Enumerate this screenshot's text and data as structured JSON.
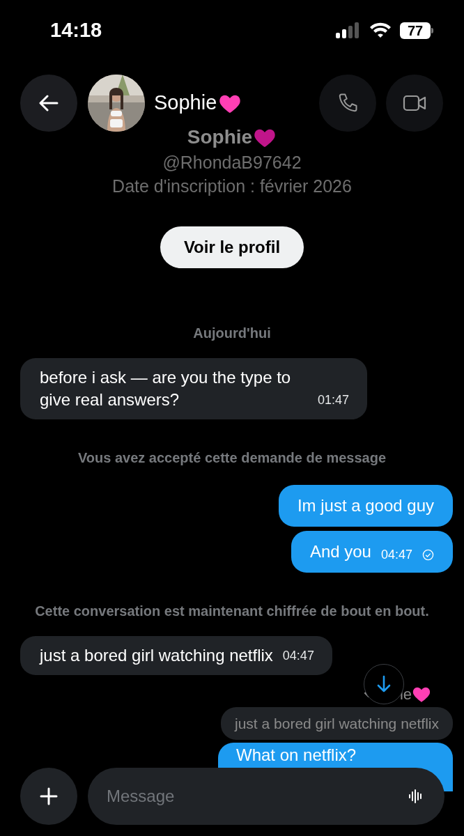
{
  "status_bar": {
    "time": "14:18",
    "battery": "77"
  },
  "header": {
    "name": "Sophie",
    "name_heart": true
  },
  "profile": {
    "name": "Sophie",
    "name_heart": true,
    "handle": "@RhondaB97642",
    "joined": "Date d'inscription : février 2026",
    "button": "Voir le profil"
  },
  "messages": [
    {
      "kind": "date",
      "text": "Aujourd'hui"
    },
    {
      "kind": "incoming",
      "text": "before i ask — are you the type to give real answers?",
      "time": "01:47"
    },
    {
      "kind": "notice",
      "text": "Vous avez accepté cette demande de message"
    },
    {
      "kind": "outgoing",
      "text": "Im just a good guy"
    },
    {
      "kind": "outgoing",
      "text": "And you",
      "time": "04:47",
      "read": true
    },
    {
      "kind": "notice",
      "text": "Cette conversation est maintenant chiffrée de bout en bout."
    },
    {
      "kind": "incoming",
      "text": "just a bored girl watching netflix",
      "time": "04:47"
    },
    {
      "kind": "reply_label",
      "text": "ie",
      "heart": true
    },
    {
      "kind": "quote",
      "text": "just a bored girl watching netflix"
    },
    {
      "kind": "outgoing_cut",
      "text": "What on netflix?"
    }
  ],
  "composer": {
    "placeholder": "Message"
  }
}
